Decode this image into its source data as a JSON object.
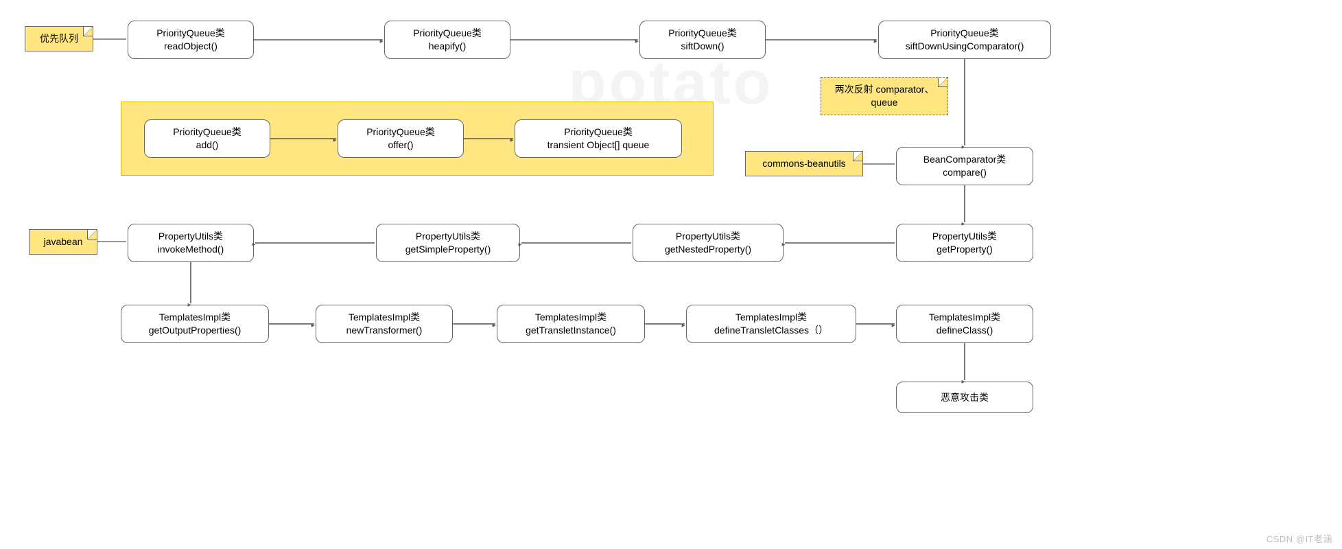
{
  "watermark": "potato",
  "attribution": "CSDN @IT老涵",
  "notes": {
    "priority_queue": "优先队列",
    "reflection": "两次反射\ncomparator、queue",
    "commons_beanutils": "commons-beanutils",
    "javabean": "javabean"
  },
  "nodes": {
    "pq_readObject": "PriorityQueue类\nreadObject()",
    "pq_heapify": "PriorityQueue类\nheapify()",
    "pq_siftDown": "PriorityQueue类\nsiftDown()",
    "pq_siftDownCmp": "PriorityQueue类\nsiftDownUsingComparator()",
    "pq_add": "PriorityQueue类\nadd()",
    "pq_offer": "PriorityQueue类\noffer()",
    "pq_queue": "PriorityQueue类\ntransient Object[] queue",
    "bc_compare": "BeanComparator类\ncompare()",
    "pu_getProperty": "PropertyUtils类\ngetProperty()",
    "pu_getNested": "PropertyUtils类\ngetNestedProperty()",
    "pu_getSimple": "PropertyUtils类\ngetSimpleProperty()",
    "pu_invokeMethod": "PropertyUtils类\ninvokeMethod()",
    "ti_getOutputProps": "TemplatesImpl类\ngetOutputProperties()",
    "ti_newTransformer": "TemplatesImpl类\nnewTransformer()",
    "ti_getTransletInst": "TemplatesImpl类\ngetTransletInstance()",
    "ti_defineTransletCls": "TemplatesImpl类\ndefineTransletClasses（）",
    "ti_defineClass": "TemplatesImpl类\ndefineClass()",
    "malicious": "恶意攻击类"
  },
  "chart_data": {
    "type": "flowchart",
    "title": "",
    "nodes": [
      {
        "id": "n1",
        "label": "PriorityQueue类 readObject()"
      },
      {
        "id": "n2",
        "label": "PriorityQueue类 heapify()"
      },
      {
        "id": "n3",
        "label": "PriorityQueue类 siftDown()"
      },
      {
        "id": "n4",
        "label": "PriorityQueue类 siftDownUsingComparator()"
      },
      {
        "id": "n5",
        "label": "BeanComparator类 compare()"
      },
      {
        "id": "n6",
        "label": "PropertyUtils类 getProperty()"
      },
      {
        "id": "n7",
        "label": "PropertyUtils类 getNestedProperty()"
      },
      {
        "id": "n8",
        "label": "PropertyUtils类 getSimpleProperty()"
      },
      {
        "id": "n9",
        "label": "PropertyUtils类 invokeMethod()"
      },
      {
        "id": "n10",
        "label": "TemplatesImpl类 getOutputProperties()"
      },
      {
        "id": "n11",
        "label": "TemplatesImpl类 newTransformer()"
      },
      {
        "id": "n12",
        "label": "TemplatesImpl类 getTransletInstance()"
      },
      {
        "id": "n13",
        "label": "TemplatesImpl类 defineTransletClasses（）"
      },
      {
        "id": "n14",
        "label": "TemplatesImpl类 defineClass()"
      },
      {
        "id": "n15",
        "label": "恶意攻击类"
      },
      {
        "id": "g1",
        "label": "PriorityQueue类 add()"
      },
      {
        "id": "g2",
        "label": "PriorityQueue类 offer()"
      },
      {
        "id": "g3",
        "label": "PriorityQueue类 transient Object[] queue"
      }
    ],
    "edges": [
      [
        "n1",
        "n2"
      ],
      [
        "n2",
        "n3"
      ],
      [
        "n3",
        "n4"
      ],
      [
        "n4",
        "n5"
      ],
      [
        "n5",
        "n6"
      ],
      [
        "n6",
        "n7"
      ],
      [
        "n7",
        "n8"
      ],
      [
        "n8",
        "n9"
      ],
      [
        "n9",
        "n10"
      ],
      [
        "n10",
        "n11"
      ],
      [
        "n11",
        "n12"
      ],
      [
        "n12",
        "n13"
      ],
      [
        "n13",
        "n14"
      ],
      [
        "n14",
        "n15"
      ],
      [
        "g1",
        "g2"
      ],
      [
        "g2",
        "g3"
      ]
    ],
    "annotations": [
      {
        "target": "n1",
        "text": "优先队列"
      },
      {
        "target": "n4->n5",
        "text": "两次反射 comparator、queue"
      },
      {
        "target": "n5",
        "text": "commons-beanutils"
      },
      {
        "target": "n9",
        "text": "javabean"
      }
    ]
  }
}
